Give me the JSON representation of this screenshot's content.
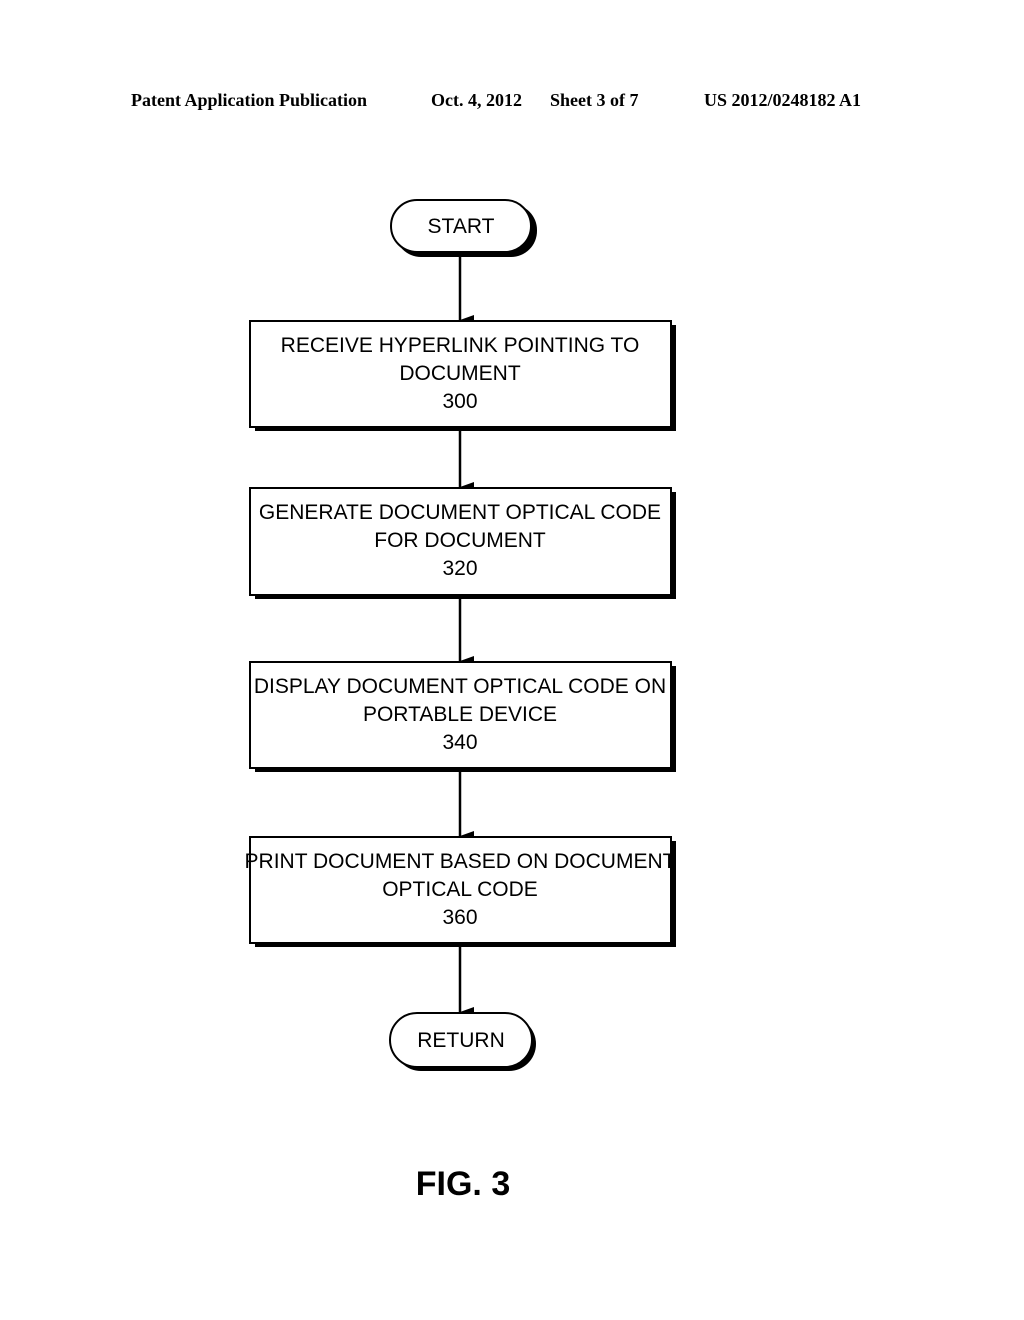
{
  "header": {
    "publication": "Patent Application Publication",
    "date": "Oct. 4, 2012",
    "sheet": "Sheet 3 of 7",
    "number": "US 2012/0248182 A1"
  },
  "flowchart": {
    "start": "START",
    "steps": [
      {
        "lines": [
          "RECEIVE HYPERLINK POINTING TO",
          "DOCUMENT"
        ],
        "ref": "300"
      },
      {
        "lines": [
          "GENERATE DOCUMENT OPTICAL CODE",
          "FOR DOCUMENT"
        ],
        "ref": "320"
      },
      {
        "lines": [
          "DISPLAY DOCUMENT OPTICAL CODE ON",
          "PORTABLE DEVICE"
        ],
        "ref": "340"
      },
      {
        "lines": [
          "PRINT DOCUMENT BASED ON DOCUMENT",
          "OPTICAL CODE"
        ],
        "ref": "360"
      }
    ],
    "end": "RETURN"
  },
  "figure_label": "FIG. 3"
}
